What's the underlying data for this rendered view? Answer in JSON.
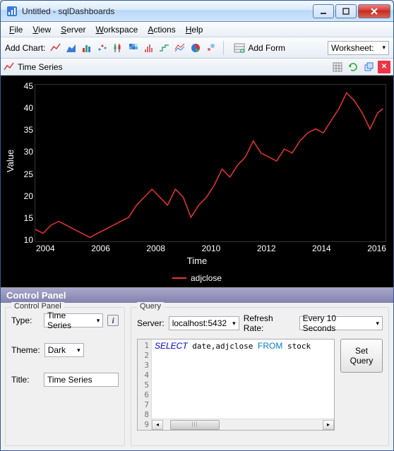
{
  "window": {
    "title": "Untitled - sqlDashboards"
  },
  "menu": {
    "file": "File",
    "view": "View",
    "server": "Server",
    "workspace": "Workspace",
    "actions": "Actions",
    "help": "Help"
  },
  "toolbar": {
    "add_chart_label": "Add Chart:",
    "add_form_label": "Add Form",
    "worksheet_label": "Worksheet:"
  },
  "panel": {
    "title": "Time Series"
  },
  "chart_data": {
    "type": "line",
    "title": "",
    "xlabel": "Time",
    "ylabel": "Value",
    "series": [
      {
        "name": "adjclose",
        "color": "#e33333"
      }
    ],
    "x_ticks": [
      "2004",
      "2006",
      "2008",
      "2010",
      "2012",
      "2014",
      "2016"
    ],
    "y_ticks": [
      45,
      40,
      35,
      30,
      25,
      20,
      15,
      10
    ],
    "ylim": [
      8,
      47
    ],
    "xlim": [
      2003,
      2016.5
    ],
    "data": [
      {
        "x": 2003.0,
        "y": 11
      },
      {
        "x": 2003.3,
        "y": 10
      },
      {
        "x": 2003.6,
        "y": 12
      },
      {
        "x": 2003.9,
        "y": 13
      },
      {
        "x": 2004.2,
        "y": 12
      },
      {
        "x": 2004.5,
        "y": 11
      },
      {
        "x": 2004.8,
        "y": 10
      },
      {
        "x": 2005.1,
        "y": 9
      },
      {
        "x": 2005.4,
        "y": 10
      },
      {
        "x": 2005.7,
        "y": 11
      },
      {
        "x": 2006.0,
        "y": 12
      },
      {
        "x": 2006.3,
        "y": 13
      },
      {
        "x": 2006.6,
        "y": 14
      },
      {
        "x": 2006.9,
        "y": 17
      },
      {
        "x": 2007.2,
        "y": 19
      },
      {
        "x": 2007.5,
        "y": 21
      },
      {
        "x": 2007.8,
        "y": 19
      },
      {
        "x": 2008.1,
        "y": 17
      },
      {
        "x": 2008.4,
        "y": 21
      },
      {
        "x": 2008.7,
        "y": 19
      },
      {
        "x": 2009.0,
        "y": 14
      },
      {
        "x": 2009.3,
        "y": 17
      },
      {
        "x": 2009.6,
        "y": 19
      },
      {
        "x": 2009.9,
        "y": 22
      },
      {
        "x": 2010.2,
        "y": 26
      },
      {
        "x": 2010.5,
        "y": 24
      },
      {
        "x": 2010.8,
        "y": 27
      },
      {
        "x": 2011.1,
        "y": 29
      },
      {
        "x": 2011.4,
        "y": 33
      },
      {
        "x": 2011.7,
        "y": 30
      },
      {
        "x": 2012.0,
        "y": 29
      },
      {
        "x": 2012.3,
        "y": 28
      },
      {
        "x": 2012.6,
        "y": 31
      },
      {
        "x": 2012.9,
        "y": 30
      },
      {
        "x": 2013.2,
        "y": 33
      },
      {
        "x": 2013.5,
        "y": 35
      },
      {
        "x": 2013.8,
        "y": 36
      },
      {
        "x": 2014.1,
        "y": 35
      },
      {
        "x": 2014.4,
        "y": 38
      },
      {
        "x": 2014.7,
        "y": 41
      },
      {
        "x": 2015.0,
        "y": 45
      },
      {
        "x": 2015.3,
        "y": 43
      },
      {
        "x": 2015.6,
        "y": 40
      },
      {
        "x": 2015.9,
        "y": 36
      },
      {
        "x": 2016.2,
        "y": 40
      },
      {
        "x": 2016.4,
        "y": 41
      }
    ]
  },
  "control_panel": {
    "bar_title": "Control Panel",
    "left_legend": "Control Panel",
    "type_label": "Type:",
    "type_value": "Time Series",
    "theme_label": "Theme:",
    "theme_value": "Dark",
    "title_label": "Title:",
    "title_value": "Time Series"
  },
  "query": {
    "legend": "Query",
    "server_label": "Server:",
    "server_value": "localhost:5432",
    "refresh_label": "Refresh Rate:",
    "refresh_value": "Every 10 Seconds",
    "sql": "SELECT date,adjclose FROM stock",
    "set_query_label": "Set\nQuery",
    "line_numbers": [
      1,
      2,
      3,
      4,
      5,
      6,
      7,
      8,
      9
    ]
  }
}
